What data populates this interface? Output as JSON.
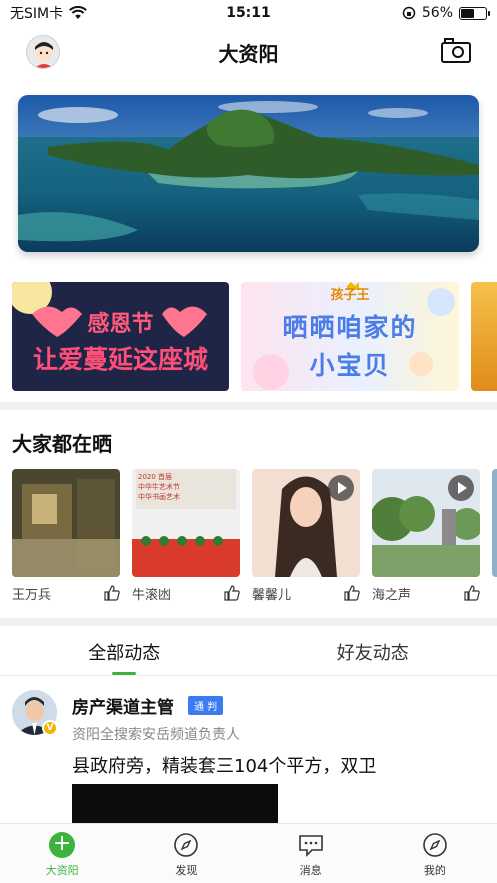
{
  "status": {
    "carrier": "无SIM卡",
    "time": "15:11",
    "battery_percent": "56%",
    "battery_level": 0.56
  },
  "header": {
    "title": "大资阳"
  },
  "promos": [
    {
      "line1": "感恩节",
      "line2": "让爱蔓延这座城"
    },
    {
      "small": "孩子王",
      "line1": "晒晒咱家的",
      "line2": "小宝贝"
    }
  ],
  "showcase": {
    "title": "大家都在晒",
    "items": [
      {
        "name": "王万兵",
        "has_video": false
      },
      {
        "name": "牛滚凼",
        "has_video": false,
        "caption1": "2020 首届",
        "caption2": "中华牛艺术节",
        "caption3": "中华书画艺术"
      },
      {
        "name": "馨馨儿",
        "has_video": true
      },
      {
        "name": "海之声",
        "has_video": true
      }
    ]
  },
  "feed_tabs": [
    {
      "label": "全部动态",
      "active": true
    },
    {
      "label": "好友动态",
      "active": false
    }
  ],
  "post": {
    "author": "房产渠道主管",
    "badge": "通 判",
    "subtitle": "资阳全搜索安岳频道负责人",
    "text": "县政府旁，精装套三104个平方，双卫"
  },
  "bottom_nav": [
    {
      "label": "大资阳",
      "icon": "plus-icon",
      "active": true
    },
    {
      "label": "发现",
      "icon": "compass-icon",
      "active": false
    },
    {
      "label": "消息",
      "icon": "message-icon",
      "active": false
    },
    {
      "label": "我的",
      "icon": "profile-compass-icon",
      "active": false
    }
  ],
  "colors": {
    "accent": "#3db33d",
    "badge": "#3a7bf2"
  }
}
